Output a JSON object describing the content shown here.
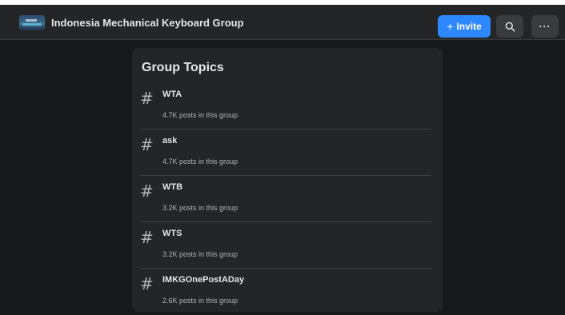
{
  "header": {
    "group_name": "Indonesia Mechanical Keyboard Group",
    "invite_label": "Invite",
    "invite_icon": "plus-icon",
    "search_icon": "search-icon",
    "more_icon": "more-icon",
    "more_label": "···"
  },
  "card": {
    "title": "Group Topics",
    "topics": [
      {
        "name": "WTA",
        "count": "4.7K posts in this group"
      },
      {
        "name": "ask",
        "count": "4.7K posts in this group"
      },
      {
        "name": "WTB",
        "count": "3.2K posts in this group"
      },
      {
        "name": "WTS",
        "count": "3.2K posts in this group"
      },
      {
        "name": "IMKGOnePostADay",
        "count": "2.6K posts in this group"
      }
    ],
    "hash_symbol": "#"
  },
  "colors": {
    "background": "#18191a",
    "surface": "#242526",
    "accent": "#2d88ff",
    "text_primary": "#e4e6eb",
    "text_secondary": "#b0b3b8"
  }
}
